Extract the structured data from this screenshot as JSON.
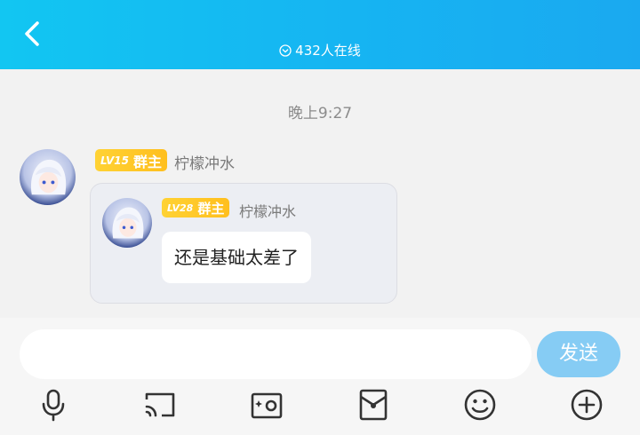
{
  "header": {
    "online_text": "432人在线"
  },
  "chat": {
    "timestamp": "晚上9:27",
    "message": {
      "badge_level": "LV15",
      "badge_role": "群主",
      "sender_name": "柠檬冲水",
      "quote": {
        "badge_level": "LV28",
        "badge_role": "群主",
        "sender_name": "柠檬冲水",
        "text": "还是基础太差了"
      }
    }
  },
  "composer": {
    "input_value": "",
    "send_label": "发送"
  },
  "toolbar": {
    "icons": [
      "microphone-icon",
      "cast-screen-icon",
      "photo-icon",
      "red-envelope-icon",
      "emoji-icon",
      "plus-icon"
    ]
  },
  "colors": {
    "header_gradient_start": "#12c6f2",
    "header_gradient_end": "#1aa9f0",
    "badge_gold": "#ffc72a",
    "send_button": "#86ccf4"
  }
}
